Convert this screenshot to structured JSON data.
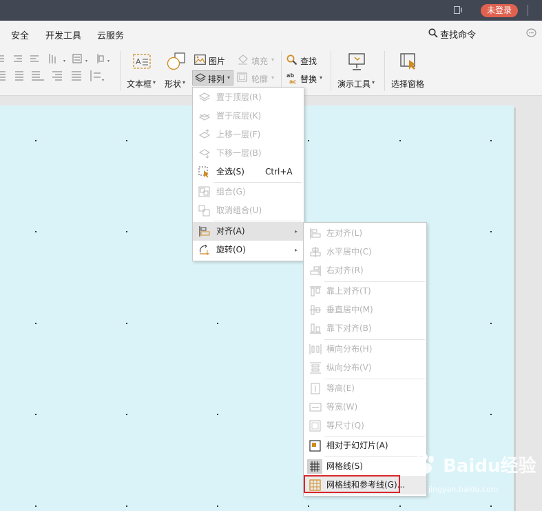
{
  "titlebar": {
    "login_label": "未登录"
  },
  "menubar": {
    "items": [
      "安全",
      "开发工具",
      "云服务"
    ],
    "search_label": "查找命令"
  },
  "ribbon": {
    "textbox_label": "文本框",
    "shape_label": "形状",
    "picture_label": "图片",
    "arrange_label": "排列",
    "fill_label": "填充",
    "outline_label": "轮廓",
    "find_label": "查找",
    "replace_label": "替换",
    "present_tools_label": "演示工具",
    "selection_pane_label": "选择窗格"
  },
  "arrange_menu": {
    "items": [
      {
        "label": "置于顶层(R)",
        "icon": "bring-to-front-icon"
      },
      {
        "label": "置于底层(K)",
        "icon": "send-to-back-icon"
      },
      {
        "label": "上移一层(F)",
        "icon": "bring-forward-icon"
      },
      {
        "label": "下移一层(B)",
        "icon": "send-backward-icon"
      },
      {
        "label": "全选(S)",
        "shortcut": "Ctrl+A",
        "icon": "select-all-icon"
      },
      {
        "label": "组合(G)",
        "icon": "group-icon"
      },
      {
        "label": "取消组合(U)",
        "icon": "ungroup-icon"
      },
      {
        "label": "对齐(A)",
        "icon": "align-icon"
      },
      {
        "label": "旋转(O)",
        "icon": "rotate-icon"
      }
    ]
  },
  "align_menu": {
    "items": [
      {
        "label": "左对齐(L)",
        "icon": "align-left-icon"
      },
      {
        "label": "水平居中(C)",
        "icon": "align-center-icon"
      },
      {
        "label": "右对齐(R)",
        "icon": "align-right-icon"
      },
      {
        "label": "靠上对齐(T)",
        "icon": "align-top-icon"
      },
      {
        "label": "垂直居中(M)",
        "icon": "align-middle-icon"
      },
      {
        "label": "靠下对齐(B)",
        "icon": "align-bottom-icon"
      },
      {
        "label": "横向分布(H)",
        "icon": "distribute-horizontal-icon"
      },
      {
        "label": "纵向分布(V)",
        "icon": "distribute-vertical-icon"
      },
      {
        "label": "等高(E)",
        "icon": "same-height-icon"
      },
      {
        "label": "等宽(W)",
        "icon": "same-width-icon"
      },
      {
        "label": "等尺寸(Q)",
        "icon": "same-size-icon"
      },
      {
        "label": "相对于幻灯片(A)",
        "icon": "relative-to-slide-icon"
      },
      {
        "label": "网格线(S)",
        "icon": "gridlines-icon"
      },
      {
        "label": "网格线和参考线(G)...",
        "icon": "grid-and-guides-icon"
      }
    ]
  },
  "watermark": {
    "brand": "Baidu经验",
    "url": "jingyan.baidu.com"
  },
  "colors": {
    "highlight_box": "#d9262c",
    "slide_bg": "#daf3f8",
    "login_btn": "#e0614f"
  }
}
